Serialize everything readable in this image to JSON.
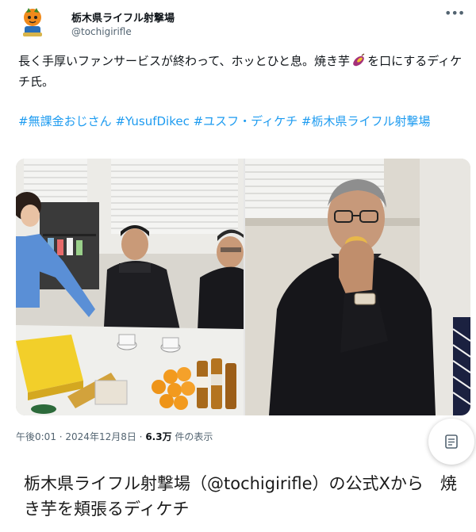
{
  "post": {
    "display_name": "栃木県ライフル射撃場",
    "handle": "@tochigirifle",
    "more_icon": "more-icon",
    "text_before_icon": "長く手厚いファンサービスが終わって、ホッとひと息。焼き芋",
    "text_after_icon": "を口にするディケチ氏。",
    "inline_icon": "sweet-potato-icon",
    "hashtags": [
      "#無課金おじさん",
      "#YusufDikec",
      "#ユスフ・ディケチ",
      "#栃木県ライフル射撃場"
    ],
    "meta": {
      "time": "午後0:01",
      "separator": " · ",
      "date": "2024年12月8日",
      "view_count": "6.3万",
      "views_label": " 件の表示"
    }
  },
  "caption": "栃木県ライフル射撃場（@tochigirifle）の公式Xから　焼き芋を頬張るディケチ",
  "colors": {
    "link": "#1d9bf0",
    "text": "#0f1419",
    "secondary": "#536471"
  }
}
